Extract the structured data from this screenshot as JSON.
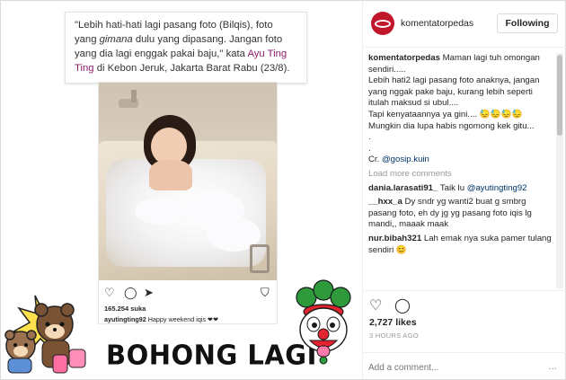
{
  "quote": {
    "line1": "\"Lebih hati-hati lagi pasang foto (Bilqis), foto yang",
    "line2_italic": "gimana",
    "line2_rest": " dulu yang dipasang. Jangan foto yang dia",
    "line3": "lagi enggak pakai baju,\" kata ",
    "highlight": "Ayu Ting Ting",
    "line3_end": " di",
    "line4": "Kebon Jeruk, Jakarta Barat Rabu (23/8)."
  },
  "embedded_post": {
    "likes": "165.254 suka",
    "caption_user": "ayutingting92",
    "caption_text": " Happy weekend iqis ❤❤"
  },
  "overlay_text": "BOHONG LAGI",
  "header": {
    "username": "komentatorpedas",
    "follow_label": "Following"
  },
  "caption": {
    "user": "komentatorpedas",
    "text": " Maman lagi tuh omongan sendiri.....\nLebih hati2 lagi pasang foto anaknya, jangan yang nggak pake baju, kurang lebih seperti itulah maksud si ubul....\nTapi kenyataannya ya gini.... 😓😓😓😓\nMungkin dia lupa habis ngomong kek gitu...\n.\n.\nCr. ",
    "credit": "@gosip.kuin"
  },
  "load_more": "Load more comments",
  "comments": [
    {
      "user": "dania.larasati91_",
      "text": " Taik lu ",
      "mention": "@ayutingting92"
    },
    {
      "user": "__hxx_a",
      "text": " Dy sndr yg wanti2 buat g smbrg pasang foto, eh dy jg yg pasang foto iqis lg mandi,, maaak maak",
      "mention": ""
    },
    {
      "user": "nur.bibah321",
      "text": " Lah emak nya suka pamer tulang sendiri 😊",
      "mention": ""
    }
  ],
  "actions": {
    "like_count": "2,727 likes",
    "timestamp": "3 HOURS AGO",
    "add_comment_placeholder": "Add a comment...",
    "more": "..."
  }
}
